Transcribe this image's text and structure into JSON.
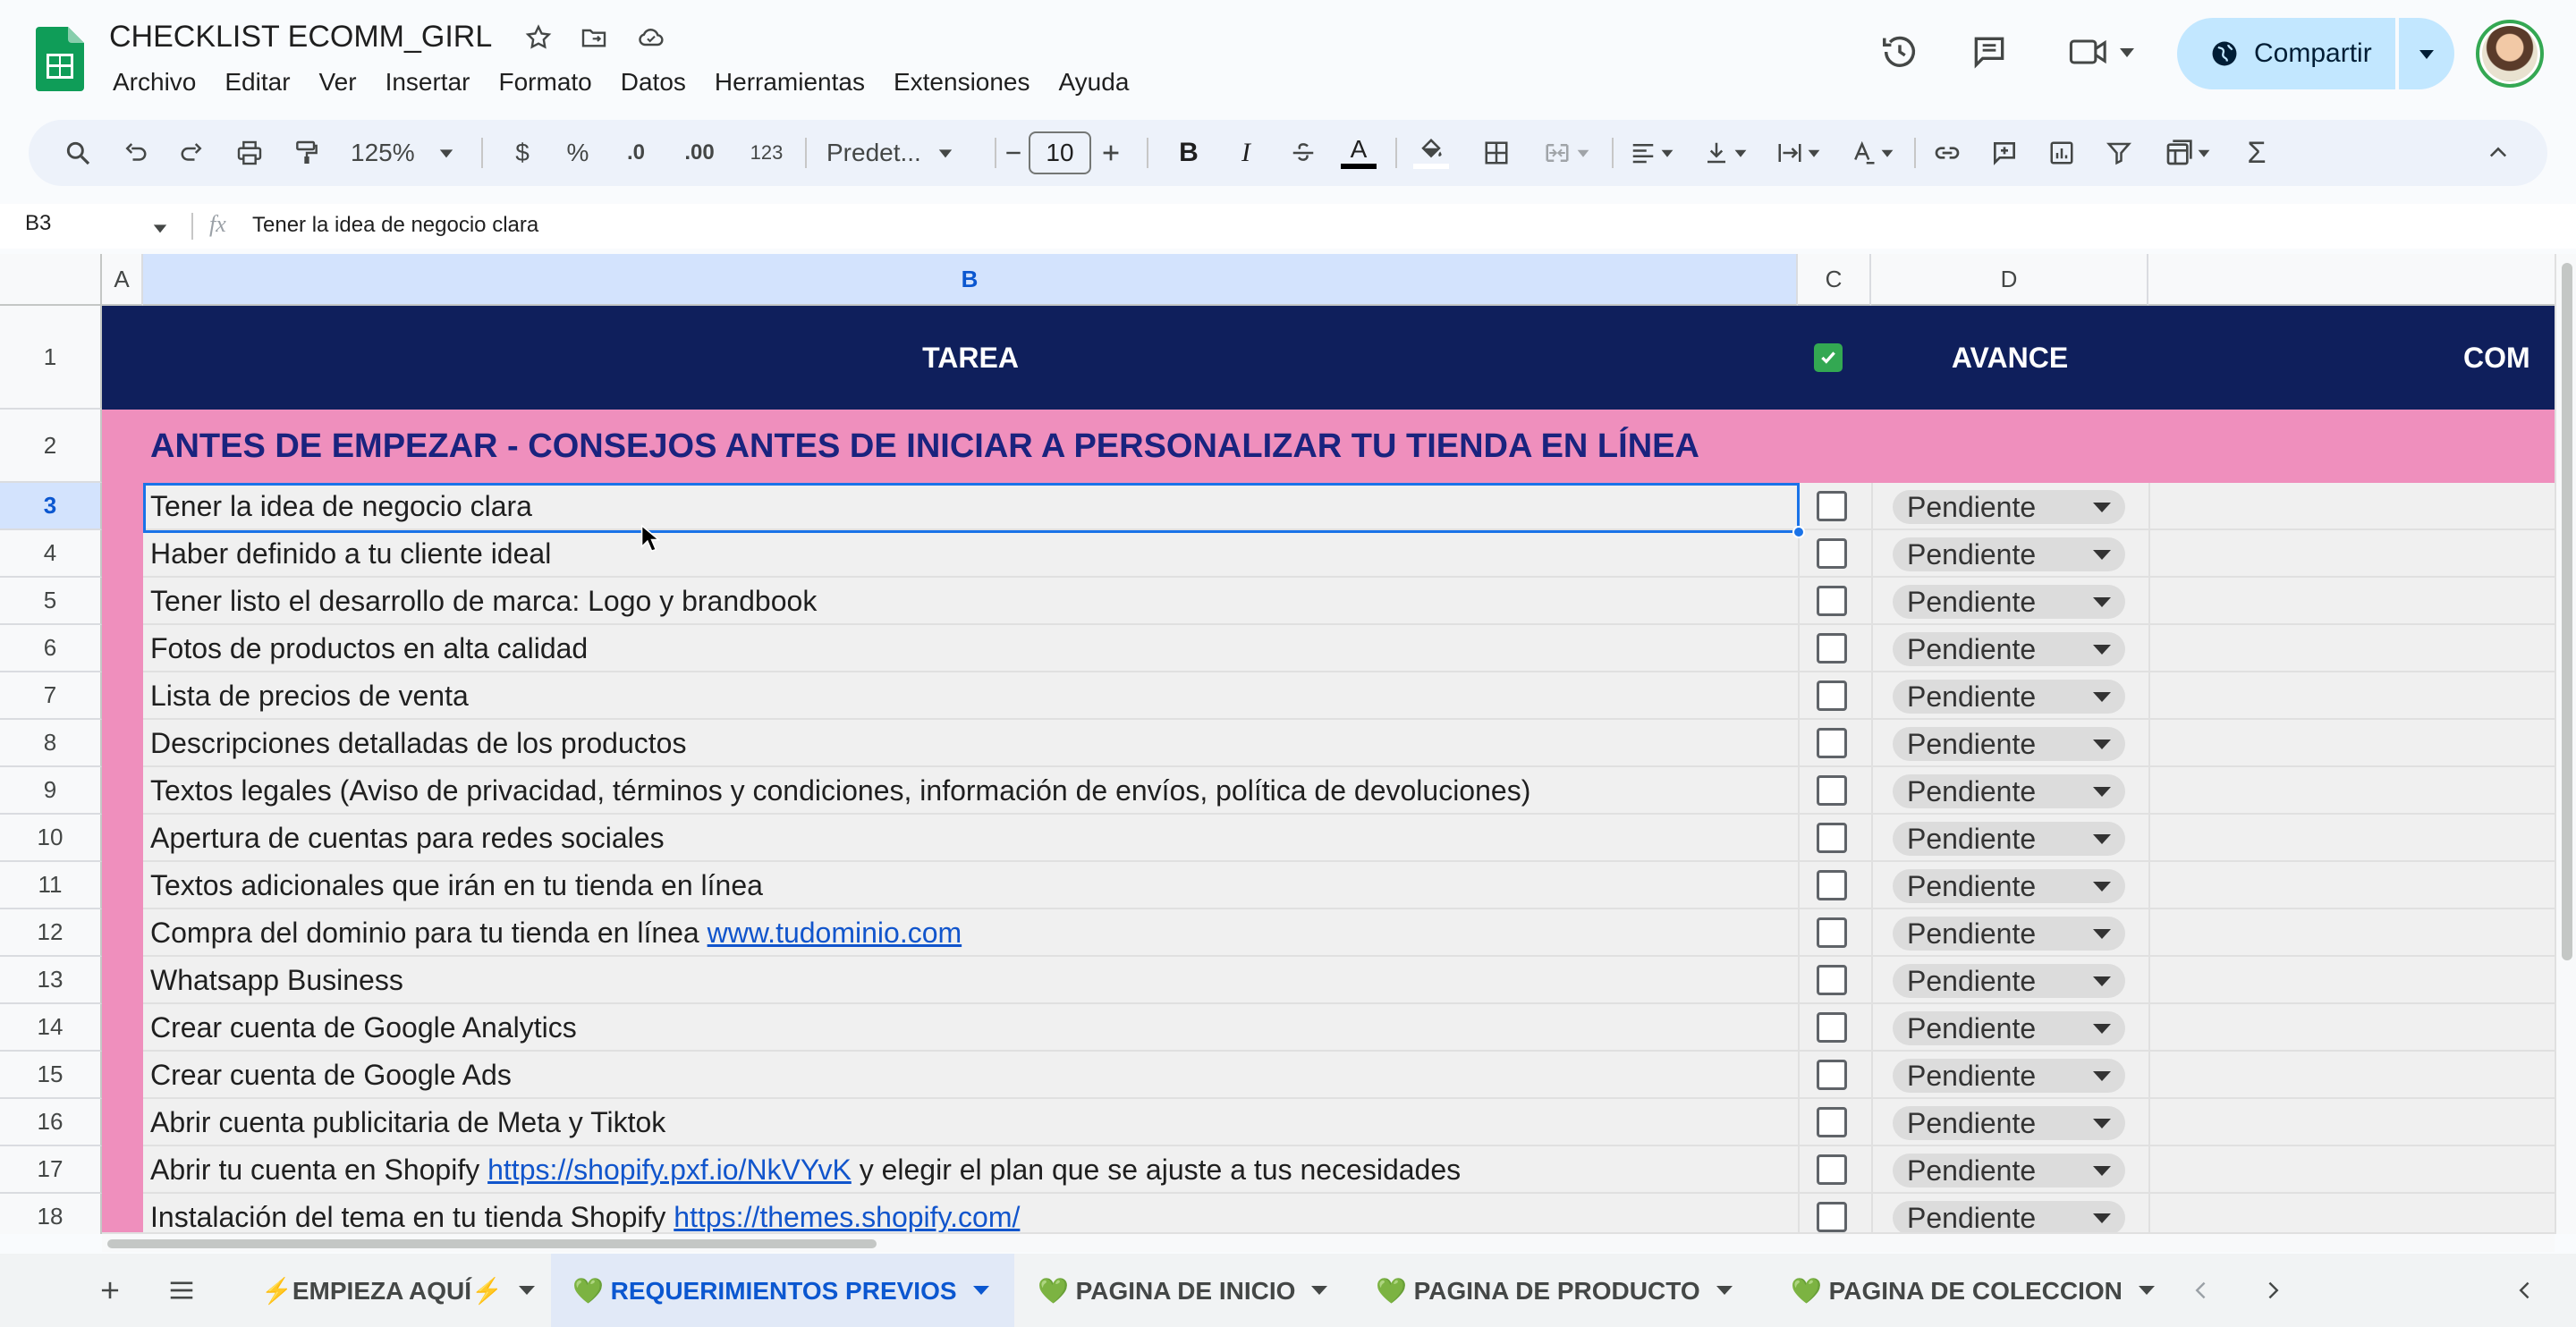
{
  "doc": {
    "title": "CHECKLIST ECOMM_GIRL"
  },
  "menu": [
    "Archivo",
    "Editar",
    "Ver",
    "Insertar",
    "Formato",
    "Datos",
    "Herramientas",
    "Extensiones",
    "Ayuda"
  ],
  "share": {
    "label": "Compartir"
  },
  "toolbar": {
    "zoom": "125%",
    "currency": "$",
    "percent": "%",
    "dec_decrease": ".0",
    "dec_increase": ".00",
    "number_format": "123",
    "font": "Predet...",
    "font_size": "10",
    "bold": "B",
    "italic": "I",
    "text_color": "A",
    "sum": "Σ"
  },
  "formula_bar": {
    "cell_ref": "B3",
    "fx": "fx",
    "content": "Tener la idea de negocio clara"
  },
  "columns": [
    "A",
    "B",
    "C",
    "D"
  ],
  "header": {
    "tarea": "TAREA",
    "avance": "AVANCE",
    "com": "COM"
  },
  "section": {
    "title": "ANTES DE EMPEZAR - CONSEJOS ANTES DE INICIAR A PERSONALIZAR TU TIENDA EN LÍNEA"
  },
  "rows": [
    {
      "num": "1"
    },
    {
      "num": "2"
    },
    {
      "num": "3",
      "task": "Tener la idea de negocio clara",
      "status": "Pendiente"
    },
    {
      "num": "4",
      "task": "Haber definido a tu cliente ideal",
      "status": "Pendiente"
    },
    {
      "num": "5",
      "task": "Tener listo el desarrollo de marca: Logo y brandbook",
      "status": "Pendiente"
    },
    {
      "num": "6",
      "task": "Fotos de productos en alta calidad",
      "status": "Pendiente"
    },
    {
      "num": "7",
      "task": "Lista de precios de venta",
      "status": "Pendiente"
    },
    {
      "num": "8",
      "task": "Descripciones detalladas de los productos",
      "status": "Pendiente"
    },
    {
      "num": "9",
      "task": "Textos legales (Aviso de privacidad, términos y condiciones, información de envíos, política de devoluciones)",
      "status": "Pendiente"
    },
    {
      "num": "10",
      "task": "Apertura de cuentas para redes sociales",
      "status": "Pendiente"
    },
    {
      "num": "11",
      "task": "Textos adicionales que irán en tu tienda en línea",
      "status": "Pendiente"
    },
    {
      "num": "12",
      "task": "Compra del dominio para tu tienda en línea ",
      "link": "www.tudominio.com",
      "status": "Pendiente"
    },
    {
      "num": "13",
      "task": "Whatsapp Business",
      "status": "Pendiente"
    },
    {
      "num": "14",
      "task": "Crear cuenta de Google Analytics",
      "status": "Pendiente"
    },
    {
      "num": "15",
      "task": "Crear cuenta de Google Ads",
      "status": "Pendiente"
    },
    {
      "num": "16",
      "task": "Abrir cuenta publicitaria de Meta y Tiktok",
      "status": "Pendiente"
    },
    {
      "num": "17",
      "task": "Abrir tu cuenta en Shopify ",
      "link": "https://shopify.pxf.io/NkVYvK",
      "task_after": " y elegir el plan que se ajuste a tus necesidades",
      "status": "Pendiente"
    },
    {
      "num": "18",
      "task": "Instalación del tema en tu tienda Shopify ",
      "link": "https://themes.shopify.com/",
      "status": "Pendiente"
    }
  ],
  "sheet_tabs": [
    {
      "label": "⚡EMPIEZA AQUÍ⚡"
    },
    {
      "label": "💚 REQUERIMIENTOS PREVIOS",
      "active": true
    },
    {
      "label": "💚 PAGINA DE INICIO"
    },
    {
      "label": "💚 PAGINA DE PRODUCTO"
    },
    {
      "label": "💚 PAGINA DE COLECCION"
    }
  ],
  "colors": {
    "header_bg": "#0f1f5c",
    "section_bg": "#ef8fbd",
    "section_text": "#1a237e",
    "share_bg": "#c2e7ff",
    "selection": "#1a73e8"
  }
}
